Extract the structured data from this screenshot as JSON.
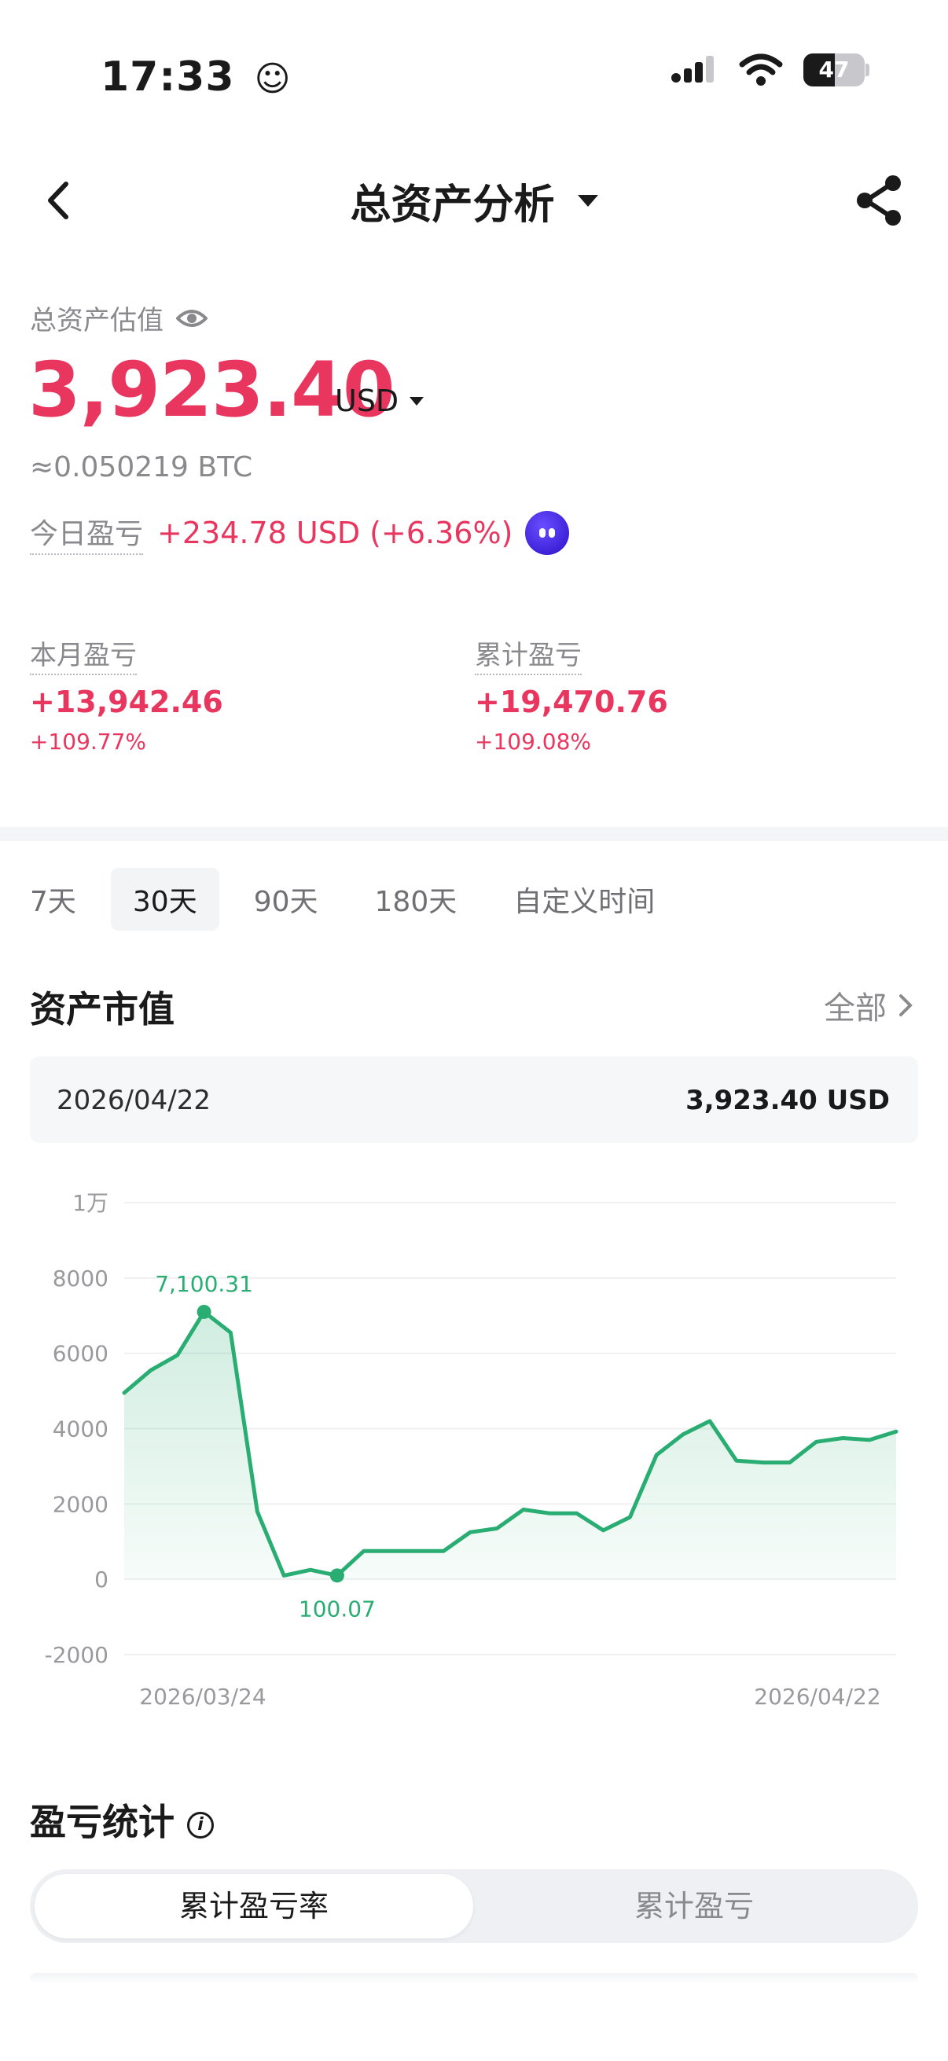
{
  "status": {
    "time": "17:33",
    "battery": "47"
  },
  "nav": {
    "title": "总资产分析"
  },
  "summary": {
    "est_label": "总资产估值",
    "value": "3,923.40",
    "currency": "USD",
    "btc": "≈0.050219 BTC",
    "today_label": "今日盈亏",
    "today_value": "+234.78 USD (+6.36%)"
  },
  "pl": {
    "month_label": "本月盈亏",
    "month_value": "+13,942.46",
    "month_pct": "+109.77%",
    "total_label": "累计盈亏",
    "total_value": "+19,470.76",
    "total_pct": "+109.08%"
  },
  "ranges": [
    "7天",
    "30天",
    "90天",
    "180天",
    "自定义时间"
  ],
  "selected_range": "30天",
  "asset": {
    "title": "资产市值",
    "all_label": "全部",
    "date": "2026/04/22",
    "value": "3,923.40 USD"
  },
  "pnl_section": {
    "title": "盈亏统计",
    "tab_rate": "累计盈亏率",
    "tab_amount": "累计盈亏"
  },
  "colors": {
    "accent_red": "#e8365f",
    "chart_green": "#2aad72"
  },
  "chart_data": {
    "type": "area",
    "x_start_label": "2026/03/24",
    "x_end_label": "2026/04/22",
    "y_ticks": [
      {
        "value": 10000,
        "label": "1万"
      },
      {
        "value": 8000,
        "label": "8000"
      },
      {
        "value": 6000,
        "label": "6000"
      },
      {
        "value": 4000,
        "label": "4000"
      },
      {
        "value": 2000,
        "label": "2000"
      },
      {
        "value": 0,
        "label": "0"
      },
      {
        "value": -2000,
        "label": "-2000"
      }
    ],
    "ylim": [
      -2000,
      10000
    ],
    "values": [
      4950,
      5550,
      5950,
      7100.31,
      6550,
      1800,
      100,
      250,
      100.07,
      750,
      750,
      750,
      750,
      1250,
      1350,
      1850,
      1750,
      1750,
      1300,
      1650,
      3300,
      3850,
      4200,
      3150,
      3100,
      3100,
      3650,
      3750,
      3700,
      3923.4
    ],
    "max": {
      "index": 3,
      "label": "7,100.31"
    },
    "min": {
      "index": 8,
      "label": "100.07"
    },
    "grid": true
  }
}
